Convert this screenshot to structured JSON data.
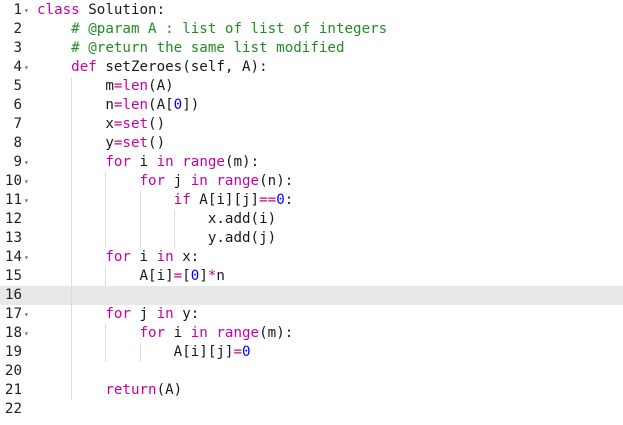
{
  "editor": {
    "active_line": 16,
    "fold_icon": "triangle-down-icon",
    "colors": {
      "keyword": "#c800a4",
      "number": "#0000ff",
      "comment": "#248c24",
      "operator": "#d2008c",
      "text": "#1a1a1a",
      "active_line_bg": "#e8e8e8"
    },
    "lines": [
      {
        "number": "1",
        "fold": "▾",
        "tokens": [
          {
            "t": "class",
            "c": "kw"
          },
          {
            "t": " Solution:",
            "c": "plain"
          }
        ]
      },
      {
        "number": "2",
        "fold": "",
        "tokens": [
          {
            "t": "    # @param A : list of list of integers",
            "c": "cm"
          }
        ]
      },
      {
        "number": "3",
        "fold": "",
        "tokens": [
          {
            "t": "    # @return the same list modified",
            "c": "cm"
          }
        ]
      },
      {
        "number": "4",
        "fold": "▾",
        "tokens": [
          {
            "t": "    ",
            "c": "plain"
          },
          {
            "t": "def",
            "c": "kw"
          },
          {
            "t": " setZeroes(self, A):",
            "c": "plain"
          }
        ]
      },
      {
        "number": "5",
        "fold": "",
        "tokens": [
          {
            "t": "        m",
            "c": "plain"
          },
          {
            "t": "=",
            "c": "op"
          },
          {
            "t": "len",
            "c": "kw"
          },
          {
            "t": "(A)",
            "c": "plain"
          }
        ]
      },
      {
        "number": "6",
        "fold": "",
        "tokens": [
          {
            "t": "        n",
            "c": "plain"
          },
          {
            "t": "=",
            "c": "op"
          },
          {
            "t": "len",
            "c": "kw"
          },
          {
            "t": "(A[",
            "c": "plain"
          },
          {
            "t": "0",
            "c": "num"
          },
          {
            "t": "])",
            "c": "plain"
          }
        ]
      },
      {
        "number": "7",
        "fold": "",
        "tokens": [
          {
            "t": "        x",
            "c": "plain"
          },
          {
            "t": "=",
            "c": "op"
          },
          {
            "t": "set",
            "c": "kw"
          },
          {
            "t": "()",
            "c": "plain"
          }
        ]
      },
      {
        "number": "8",
        "fold": "",
        "tokens": [
          {
            "t": "        y",
            "c": "plain"
          },
          {
            "t": "=",
            "c": "op"
          },
          {
            "t": "set",
            "c": "kw"
          },
          {
            "t": "()",
            "c": "plain"
          }
        ]
      },
      {
        "number": "9",
        "fold": "▾",
        "tokens": [
          {
            "t": "        ",
            "c": "plain"
          },
          {
            "t": "for",
            "c": "kw"
          },
          {
            "t": " i ",
            "c": "plain"
          },
          {
            "t": "in",
            "c": "kw"
          },
          {
            "t": " ",
            "c": "plain"
          },
          {
            "t": "range",
            "c": "kw"
          },
          {
            "t": "(m):",
            "c": "plain"
          }
        ]
      },
      {
        "number": "10",
        "fold": "▾",
        "tokens": [
          {
            "t": "            ",
            "c": "plain"
          },
          {
            "t": "for",
            "c": "kw"
          },
          {
            "t": " j ",
            "c": "plain"
          },
          {
            "t": "in",
            "c": "kw"
          },
          {
            "t": " ",
            "c": "plain"
          },
          {
            "t": "range",
            "c": "kw"
          },
          {
            "t": "(n):",
            "c": "plain"
          }
        ]
      },
      {
        "number": "11",
        "fold": "▾",
        "tokens": [
          {
            "t": "                ",
            "c": "plain"
          },
          {
            "t": "if",
            "c": "kw"
          },
          {
            "t": " A[i][j]",
            "c": "plain"
          },
          {
            "t": "==",
            "c": "op"
          },
          {
            "t": "0",
            "c": "num"
          },
          {
            "t": ":",
            "c": "plain"
          }
        ]
      },
      {
        "number": "12",
        "fold": "",
        "tokens": [
          {
            "t": "                    x.add(i)",
            "c": "plain"
          }
        ]
      },
      {
        "number": "13",
        "fold": "",
        "tokens": [
          {
            "t": "                    y.add(j)",
            "c": "plain"
          }
        ]
      },
      {
        "number": "14",
        "fold": "▾",
        "tokens": [
          {
            "t": "        ",
            "c": "plain"
          },
          {
            "t": "for",
            "c": "kw"
          },
          {
            "t": " i ",
            "c": "plain"
          },
          {
            "t": "in",
            "c": "kw"
          },
          {
            "t": " x:",
            "c": "plain"
          }
        ]
      },
      {
        "number": "15",
        "fold": "",
        "tokens": [
          {
            "t": "            A[i]",
            "c": "plain"
          },
          {
            "t": "=",
            "c": "op"
          },
          {
            "t": "[",
            "c": "plain"
          },
          {
            "t": "0",
            "c": "num"
          },
          {
            "t": "]",
            "c": "plain"
          },
          {
            "t": "*",
            "c": "op"
          },
          {
            "t": "n",
            "c": "plain"
          }
        ]
      },
      {
        "number": "16",
        "fold": "",
        "tokens": []
      },
      {
        "number": "17",
        "fold": "▾",
        "tokens": [
          {
            "t": "        ",
            "c": "plain"
          },
          {
            "t": "for",
            "c": "kw"
          },
          {
            "t": " j ",
            "c": "plain"
          },
          {
            "t": "in",
            "c": "kw"
          },
          {
            "t": " y:",
            "c": "plain"
          }
        ]
      },
      {
        "number": "18",
        "fold": "▾",
        "tokens": [
          {
            "t": "            ",
            "c": "plain"
          },
          {
            "t": "for",
            "c": "kw"
          },
          {
            "t": " i ",
            "c": "plain"
          },
          {
            "t": "in",
            "c": "kw"
          },
          {
            "t": " ",
            "c": "plain"
          },
          {
            "t": "range",
            "c": "kw"
          },
          {
            "t": "(m):",
            "c": "plain"
          }
        ]
      },
      {
        "number": "19",
        "fold": "",
        "tokens": [
          {
            "t": "                A[i][j]",
            "c": "plain"
          },
          {
            "t": "=",
            "c": "op"
          },
          {
            "t": "0",
            "c": "num"
          }
        ]
      },
      {
        "number": "20",
        "fold": "",
        "tokens": []
      },
      {
        "number": "21",
        "fold": "",
        "tokens": [
          {
            "t": "        ",
            "c": "plain"
          },
          {
            "t": "return",
            "c": "kw"
          },
          {
            "t": "(A)",
            "c": "plain"
          }
        ]
      },
      {
        "number": "22",
        "fold": "",
        "tokens": []
      }
    ]
  }
}
